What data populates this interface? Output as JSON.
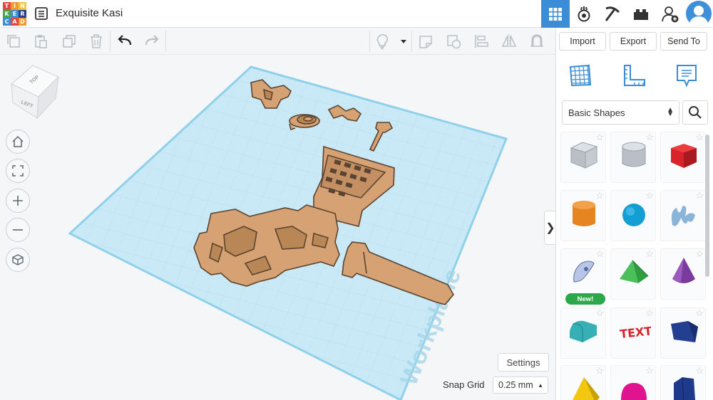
{
  "app": {
    "logo_letters": [
      "T",
      "I",
      "N",
      "K",
      "E",
      "R",
      "C",
      "A",
      "D"
    ],
    "logo_colors": [
      "#e2463f",
      "#f1992d",
      "#f2c443",
      "#4ba34b",
      "#3a8fd6",
      "#283f8f",
      "#3a8fd6",
      "#e2463f",
      "#f1992d"
    ],
    "title": "Exquisite Kasi"
  },
  "topbar": {
    "buttons": [
      "grid-view-icon",
      "circuits-icon",
      "minecraft-pickaxe-icon",
      "lego-bricks-icon",
      "add-user-icon"
    ],
    "accent_color": "#3b8dd8"
  },
  "toolbar": {
    "tools": [
      "copy-icon",
      "paste-icon",
      "duplicate-icon",
      "delete-icon",
      "undo-icon",
      "redo-icon"
    ],
    "view_tools": [
      "light-bulb-icon",
      "dropdown-arrow-icon",
      "group-icon",
      "ungroup-icon",
      "align-icon",
      "mirror-icon",
      "workplane-magnet-icon"
    ]
  },
  "actions": {
    "import": "Import",
    "export": "Export",
    "send_to": "Send To"
  },
  "panel": {
    "tabs": [
      "workplane-grid-icon",
      "ruler-icon",
      "notes-icon"
    ],
    "category": "Basic Shapes",
    "shapes": [
      {
        "name": "Box Hole",
        "color": "#b8bfc6"
      },
      {
        "name": "Cylinder Hole",
        "color": "#b8bfc6"
      },
      {
        "name": "Box",
        "color": "#d8232a"
      },
      {
        "name": "Cylinder",
        "color": "#e58420"
      },
      {
        "name": "Sphere",
        "color": "#139fd4"
      },
      {
        "name": "Scribble",
        "color": "#8ab4d8"
      },
      {
        "name": "Shape Generator",
        "color": "#b7c6e6",
        "badge": "New!"
      },
      {
        "name": "Roof",
        "color": "#2e9e3f"
      },
      {
        "name": "Cone",
        "color": "#7b3a9d"
      },
      {
        "name": "Round Roof",
        "color": "#36b0b4"
      },
      {
        "name": "Text",
        "color": "#d8232a"
      },
      {
        "name": "Wedge",
        "color": "#243e91"
      },
      {
        "name": "Pyramid",
        "color": "#f3c60f"
      },
      {
        "name": "Half Sphere",
        "color": "#e0148f"
      },
      {
        "name": "Polygon",
        "color": "#1e3a8a"
      }
    ]
  },
  "viewcube": {
    "top": "TOP",
    "left": "LEFT"
  },
  "nav_controls": [
    "home-icon",
    "fit-view-icon",
    "zoom-in-icon",
    "zoom-out-icon",
    "perspective-icon"
  ],
  "workplane": {
    "label": "Workplane",
    "plane_color": "#c9e9f6",
    "object_color": "#d6a273"
  },
  "settings": {
    "label": "Settings",
    "snap_grid_label": "Snap Grid",
    "snap_grid_value": "0.25 mm"
  }
}
